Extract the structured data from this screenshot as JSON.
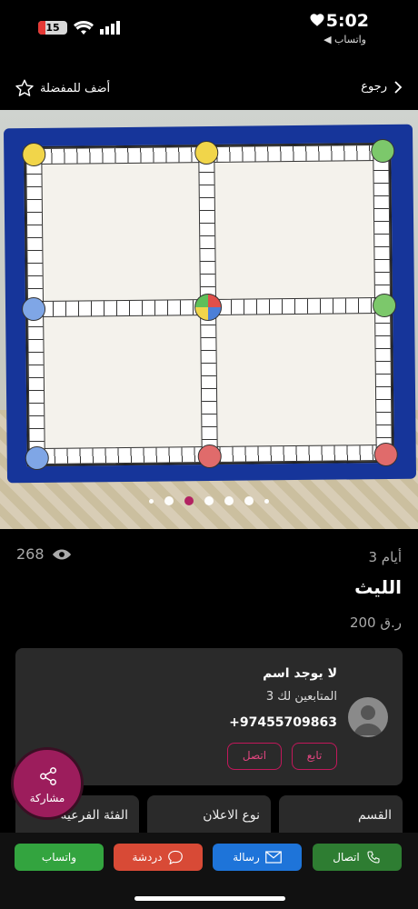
{
  "status_bar": {
    "time": "5:02",
    "back_app": "◀ واتساب",
    "battery": "15"
  },
  "nav": {
    "favorite_label": "أضف للمفضلة",
    "back_label": "رجوع"
  },
  "gallery": {
    "total_images": 7,
    "active_index": 2
  },
  "listing": {
    "views": "268",
    "age": "3 أيام",
    "title": "الليث",
    "price": "200 ر.ق"
  },
  "seller": {
    "name": "لا يوجد اسم",
    "followers_label": "المتابعين لك",
    "followers_count": "3",
    "phone": "+97455709863",
    "follow_label": "تابع",
    "call_label": "اتصل"
  },
  "tiles": [
    "القسم",
    "نوع الاعلان",
    "الفئة الفرعية"
  ],
  "share_label": "مشاركة",
  "bottom_bar": {
    "call": "اتصال",
    "message": "رسالة",
    "chat": "دردشة",
    "whatsapp": "واتساب"
  },
  "colors": {
    "accent": "#b0195e",
    "call": "#2e7d32",
    "message": "#1e74d9",
    "chat": "#d84a36",
    "whatsapp": "#33a43f"
  }
}
